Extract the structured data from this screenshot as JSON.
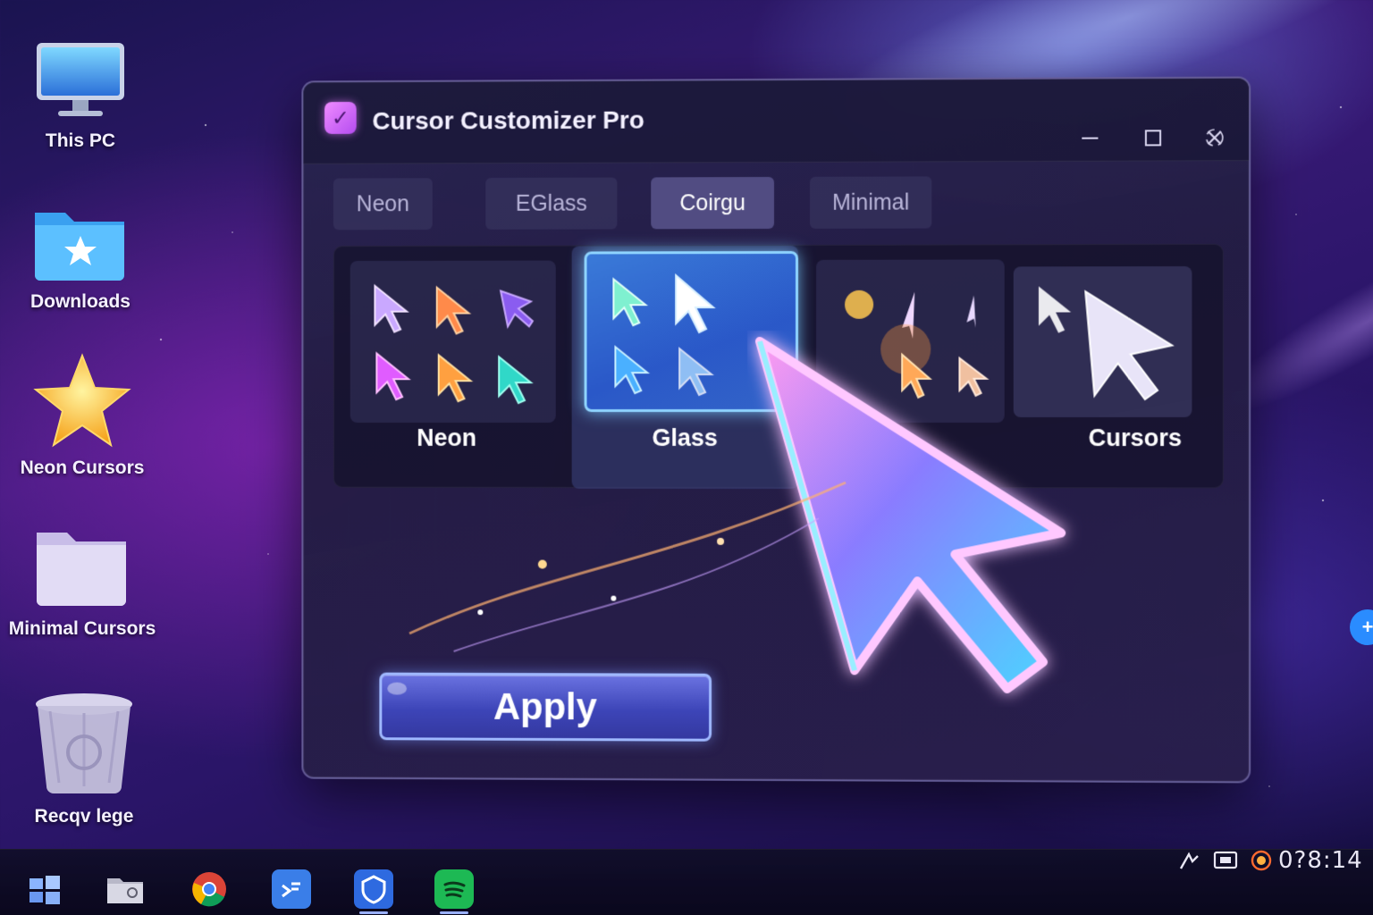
{
  "desktop": {
    "icons": [
      {
        "label": "This PC",
        "icon": "monitor-icon"
      },
      {
        "label": "Downloads",
        "icon": "folder-star-icon"
      },
      {
        "label": "Neon Cursors",
        "icon": "star-icon"
      },
      {
        "label": "Minimal Cursors",
        "icon": "folder-icon"
      },
      {
        "label": "Recqv lege",
        "icon": "recycle-bin-icon"
      }
    ]
  },
  "window": {
    "title": "Cursor Customizer Pro",
    "logo_glyph": "✓",
    "controls": {
      "minimize": "minimize-icon",
      "maximize": "maximize-icon",
      "close": "close-icon"
    },
    "tabs": [
      {
        "label": "Neon",
        "active": false
      },
      {
        "label": "EGlass",
        "active": false
      },
      {
        "label": "Coirgu",
        "active": true
      },
      {
        "label": "Minimal",
        "active": false
      }
    ],
    "themes": [
      {
        "label": "Neon",
        "selected": false
      },
      {
        "label": "Glass",
        "selected": true
      },
      {
        "label": "",
        "selected": false
      },
      {
        "label": "Cursors",
        "selected": false
      }
    ],
    "apply_label": "Apply"
  },
  "edge_button": {
    "glyph": "+"
  },
  "taskbar": {
    "apps": [
      "windows-start-icon",
      "file-explorer-icon",
      "chrome-icon",
      "vscode-icon",
      "shield-app-icon",
      "spotify-icon"
    ],
    "tray": [
      "network-icon",
      "display-icon",
      "record-icon"
    ],
    "clock": "0?8:14"
  },
  "colors": {
    "accent_blue": "#8fd4ff",
    "neon_pink": "#ff5ee8",
    "neon_cyan": "#6ff0ff",
    "apply_button": "#4a52c8"
  }
}
